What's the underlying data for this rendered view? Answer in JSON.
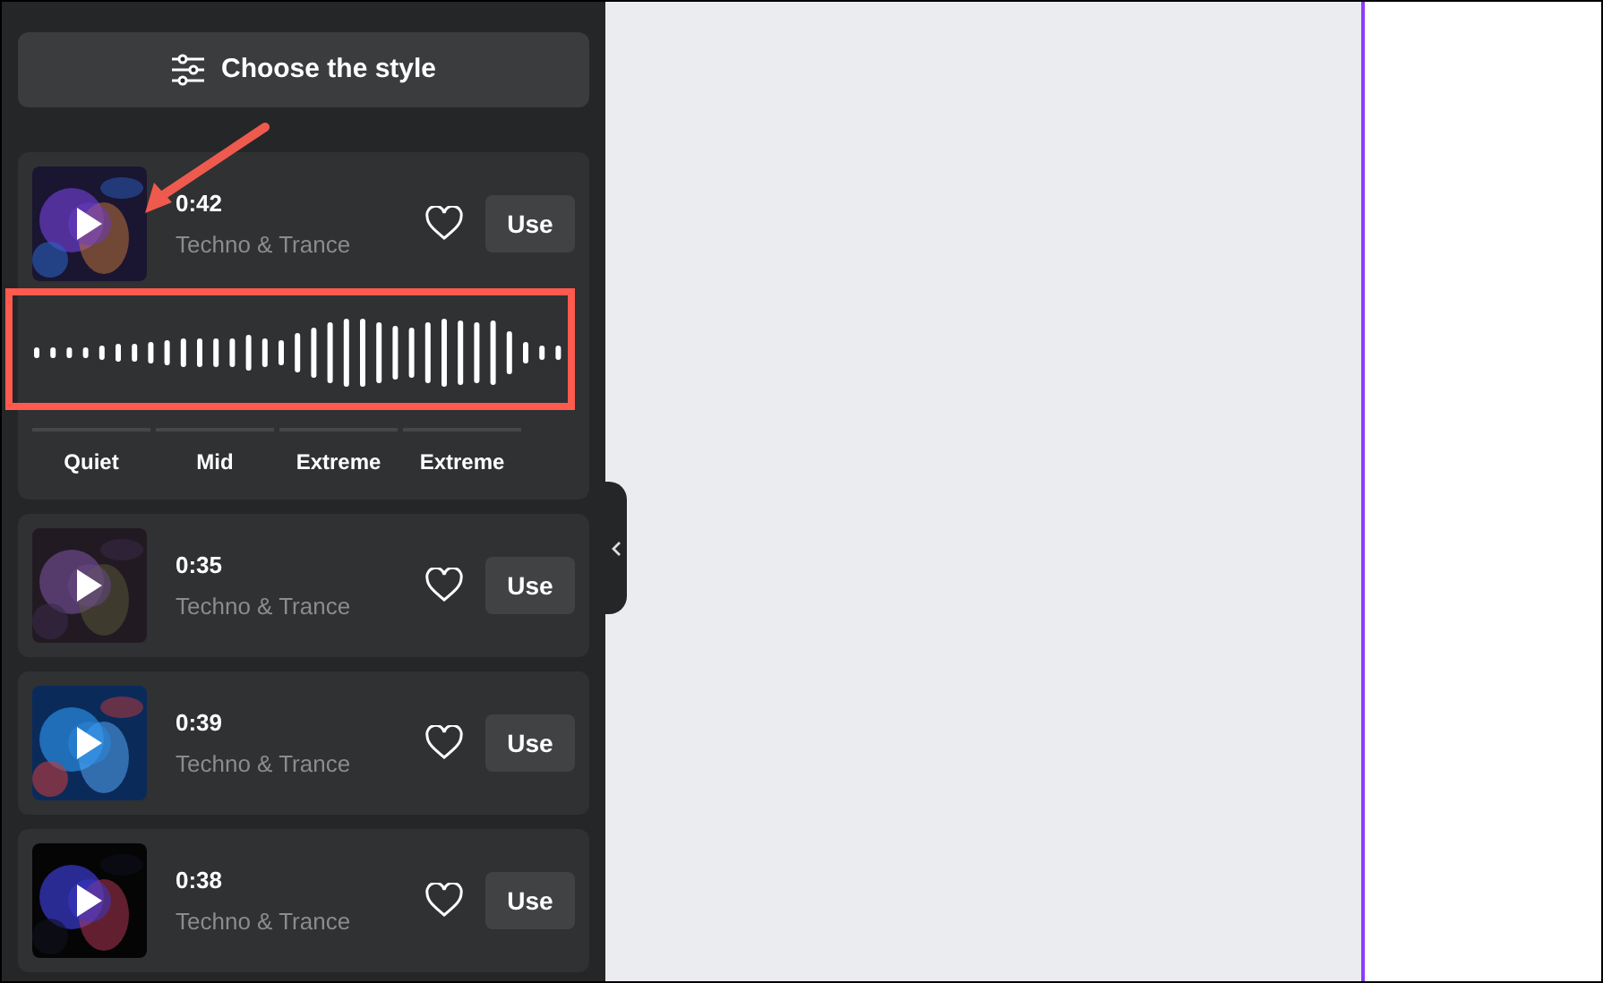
{
  "style_button": {
    "label": "Choose the style"
  },
  "tracks": [
    {
      "duration": "0:42",
      "genre": "Techno & Trance",
      "action": "Use",
      "favorite": false,
      "expanded": true,
      "levels": [
        "Quiet",
        "Mid",
        "Extreme",
        "Extreme"
      ]
    },
    {
      "duration": "0:35",
      "genre": "Techno & Trance",
      "action": "Use",
      "favorite": false,
      "expanded": false
    },
    {
      "duration": "0:39",
      "genre": "Techno & Trance",
      "action": "Use",
      "favorite": false,
      "expanded": false
    },
    {
      "duration": "0:38",
      "genre": "Techno & Trance",
      "action": "Use",
      "favorite": false,
      "expanded": false
    }
  ],
  "annotations": {
    "arrow": true,
    "highlight_box": true
  }
}
